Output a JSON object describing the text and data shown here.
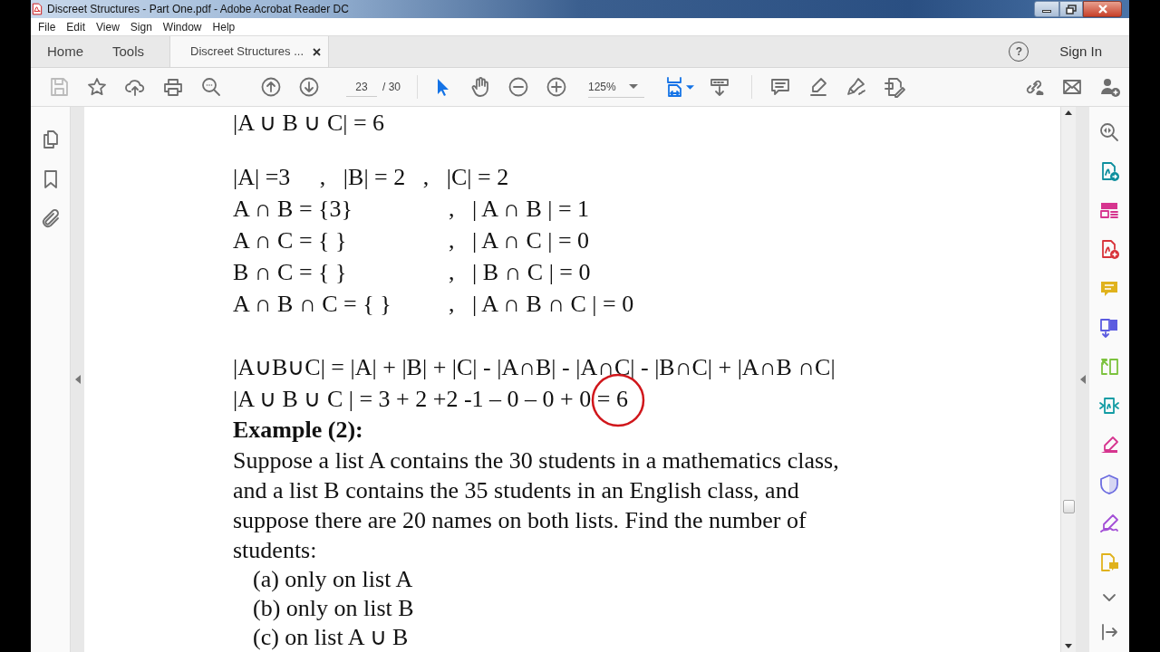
{
  "window": {
    "title": "Discreet Structures - Part One.pdf - Adobe Acrobat Reader DC"
  },
  "menu": [
    "File",
    "Edit",
    "View",
    "Sign",
    "Window",
    "Help"
  ],
  "tabs": [
    {
      "label": "Home",
      "selected": false,
      "closable": false
    },
    {
      "label": "Tools",
      "selected": false,
      "closable": false
    },
    {
      "label": "Discreet Structures ...",
      "selected": true,
      "closable": true
    }
  ],
  "account": {
    "help": "?",
    "sign_in": "Sign In"
  },
  "toolbar": {
    "page": "23",
    "page_count": "/ 30",
    "zoom": "125%",
    "tools": [
      {
        "kind": "select",
        "selected": true
      },
      {
        "kind": "hand",
        "selected": false
      }
    ]
  },
  "document": {
    "top_line": "|A ∪ B ∪ C| = 6",
    "cardinalities": "|A| =3     ,   |B| = 2   ,   |C| = 2",
    "intersections": [
      {
        "left": "A ∩ B = {3}",
        "sep": ",",
        "right": "| A ∩ B | = 1"
      },
      {
        "left": "A ∩ C = { }",
        "sep": ",",
        "right": "| A ∩ C | = 0"
      },
      {
        "left": "B ∩ C = { }",
        "sep": ",",
        "right": "| B ∩ C | = 0"
      },
      {
        "left": "A ∩ B ∩ C = { }",
        "sep": ",",
        "right": "| A ∩ B ∩ C | = 0"
      }
    ],
    "formula": "|A∪B∪C| = |A| + |B| + |C| - |A∩B| - |A∩C| - |B∩C| + |A∩B ∩C|",
    "computation": "|A ∪ B ∪ C | = 3 + 2 +2 -1 – 0 – 0 + 0 = 6",
    "example_heading": "Example (2):",
    "paragraph_lines": [
      "Suppose a list A contains the 30 students in a mathematics class,",
      "and a list B contains the 35 students in an English class, and",
      "suppose there are 20 names on both lists. Find the number of",
      "students:"
    ],
    "questions": [
      "(a) only on list A",
      "(b) only on list B",
      "(c) on list A ∪ B"
    ]
  }
}
